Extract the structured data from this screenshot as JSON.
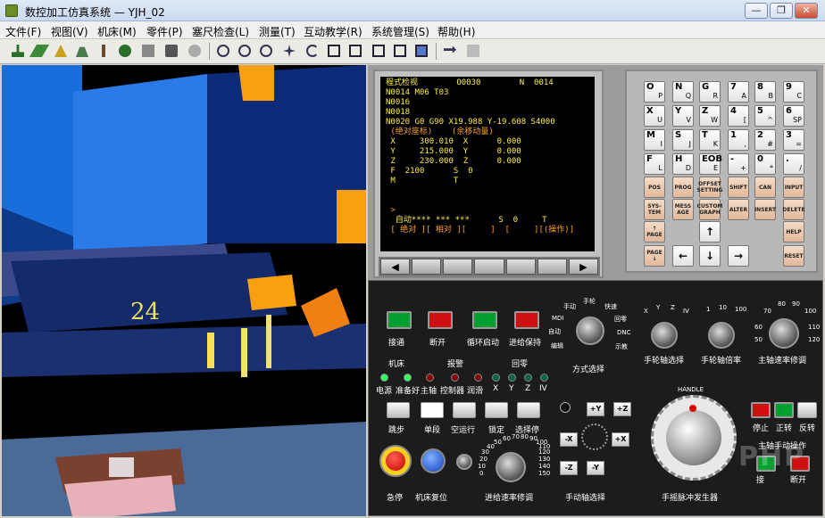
{
  "window": {
    "title": "数控加工仿真系统 — YJH_02",
    "min": "—",
    "max": "❐",
    "close": "✕"
  },
  "menu": [
    "文件(F)",
    "视图(V)",
    "机床(M)",
    "零件(P)",
    "塞尺检查(L)",
    "测量(T)",
    "互动教学(R)",
    "系统管理(S)",
    "帮助(H)"
  ],
  "viewport": {
    "label": "24"
  },
  "crt": {
    "lines": [
      "程式检视        O0030        N  0014",
      "N0014 M06 T03",
      "N0016",
      "N0018",
      "N0020 G0 G90 X19.988 Y-19.608 S4000",
      " (绝对座标)    (余移动量)",
      " X     300.010  X      0.000",
      " Y     215.000  Y      0.000",
      " Z     230.000  Z      0.000",
      " F  2100      S  0",
      " M            T",
      "",
      "",
      " >",
      "  自动**** *** ***      S  0     T",
      " [ 绝对 ][ 相对 ][     ]  [     ][(操作)]"
    ]
  },
  "softkeys": {
    "left": "◀",
    "right": "▶"
  },
  "mdi": {
    "keys": [
      [
        "O",
        "P"
      ],
      [
        "N",
        "Q"
      ],
      [
        "G",
        "R"
      ],
      [
        "7",
        "A"
      ],
      [
        "8",
        "B"
      ],
      [
        "9",
        "C"
      ],
      [
        "X",
        "U"
      ],
      [
        "Y",
        "V"
      ],
      [
        "Z",
        "W"
      ],
      [
        "4",
        "["
      ],
      [
        "5",
        "^"
      ],
      [
        "6",
        "SP"
      ],
      [
        "M",
        "I"
      ],
      [
        "S",
        "J"
      ],
      [
        "T",
        "K"
      ],
      [
        "1",
        ","
      ],
      [
        "2",
        "#"
      ],
      [
        "3",
        "="
      ],
      [
        "F",
        "L"
      ],
      [
        "H",
        "D"
      ],
      [
        "EOB",
        "E"
      ],
      [
        "-",
        "+"
      ],
      [
        "0",
        "*"
      ],
      [
        ".",
        "/"
      ]
    ],
    "fkeys": [
      "POS",
      "PROG",
      "OFFSET SETTING",
      "SHIFT",
      "CAN",
      "INPUT",
      "SYS- TEM",
      "MESS AGE",
      "CUSTOM GRAPH",
      "ALTER",
      "INSERT",
      "DELETE"
    ],
    "page_up": "↑ PAGE",
    "page_down": "PAGE ↓",
    "up": "↑",
    "down": "↓",
    "left": "←",
    "right": "→",
    "help": "HELP",
    "reset": "RESET"
  },
  "panel": {
    "buttons_top": [
      "接通",
      "断开",
      "循环启动",
      "进给保持"
    ],
    "led_groups": [
      "机床",
      "报警",
      "回零"
    ],
    "leds": [
      "电源",
      "准备好",
      "主轴",
      "控制器",
      "润滑",
      "X",
      "Y",
      "Z",
      "IV"
    ],
    "mode_labels": [
      "手动",
      "手轮",
      "快速",
      "MDI",
      "回零",
      "自动",
      "DNC",
      "编辑",
      "示教"
    ],
    "mode_title": "方式选择",
    "handwheel_axis": {
      "title": "手轮轴选择",
      "ticks": [
        "X",
        "Y",
        "Z",
        "IV"
      ]
    },
    "handwheel_rate": {
      "title": "手轮轴倍率",
      "ticks": [
        "1",
        "10",
        "100"
      ]
    },
    "spindle_rate": {
      "title": "主轴速率修调",
      "ticks": [
        "70",
        "80",
        "90",
        "100",
        "110",
        "120",
        "60",
        "50"
      ]
    },
    "func_buttons": [
      "跳步",
      "单段",
      "空运行",
      "锁定",
      "选择停"
    ],
    "estop": "急停",
    "reset": "机床复位",
    "feed_rate": {
      "title": "进给速率修调",
      "ticks": [
        "0",
        "10",
        "20",
        "30",
        "40",
        "50",
        "60",
        "70",
        "80",
        "90",
        "100",
        "110",
        "120",
        "130",
        "140",
        "150"
      ]
    },
    "jog": {
      "title": "手动轴选择",
      "keys": [
        "+Y",
        "+Z",
        "-X",
        "+X",
        "-Z",
        "-Y"
      ]
    },
    "handle": {
      "title": "手摇脉冲发生器",
      "label": "HANDLE"
    },
    "spindle": {
      "title": "主轴手动操作",
      "buttons": [
        "停止",
        "正转",
        "反转"
      ]
    },
    "coolant": {
      "buttons": [
        "接",
        "断开"
      ]
    },
    "watermark": "PHP"
  },
  "colors": {
    "green": "#00a030",
    "red": "#d01010",
    "crt": "#ffee44"
  }
}
